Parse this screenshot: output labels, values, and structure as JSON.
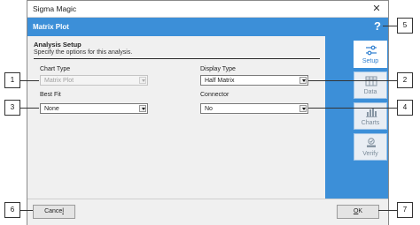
{
  "window": {
    "title": "Sigma Magic"
  },
  "header": {
    "title": "Matrix Plot",
    "help": "?"
  },
  "section": {
    "title": "Analysis Setup",
    "subtitle": "Specify the options for this analysis."
  },
  "fields": {
    "chart_type": {
      "label": "Chart Type",
      "value": "Matrix Plot",
      "enabled": false
    },
    "display_type": {
      "label": "Display Type",
      "value": "Half Matrix",
      "enabled": true
    },
    "best_fit": {
      "label": "Best Fit",
      "value": "None",
      "enabled": true
    },
    "connector": {
      "label": "Connector",
      "value": "No",
      "enabled": true
    }
  },
  "sidebar": {
    "tabs": [
      {
        "label": "Setup",
        "icon": "sliders-icon",
        "active": true
      },
      {
        "label": "Data",
        "icon": "grid-icon",
        "active": false
      },
      {
        "label": "Charts",
        "icon": "bar-chart-icon",
        "active": false
      },
      {
        "label": "Verify",
        "icon": "check-stamp-icon",
        "active": false
      }
    ]
  },
  "footer": {
    "cancel": {
      "pre": "Cance",
      "mnemonic": "l"
    },
    "ok": {
      "mnemonic": "O",
      "post": "K"
    }
  },
  "callouts": [
    "1",
    "2",
    "3",
    "4",
    "5",
    "6",
    "7"
  ],
  "colors": {
    "accent": "#3c8fd8",
    "active_tab_text": "#2f7fd0"
  }
}
